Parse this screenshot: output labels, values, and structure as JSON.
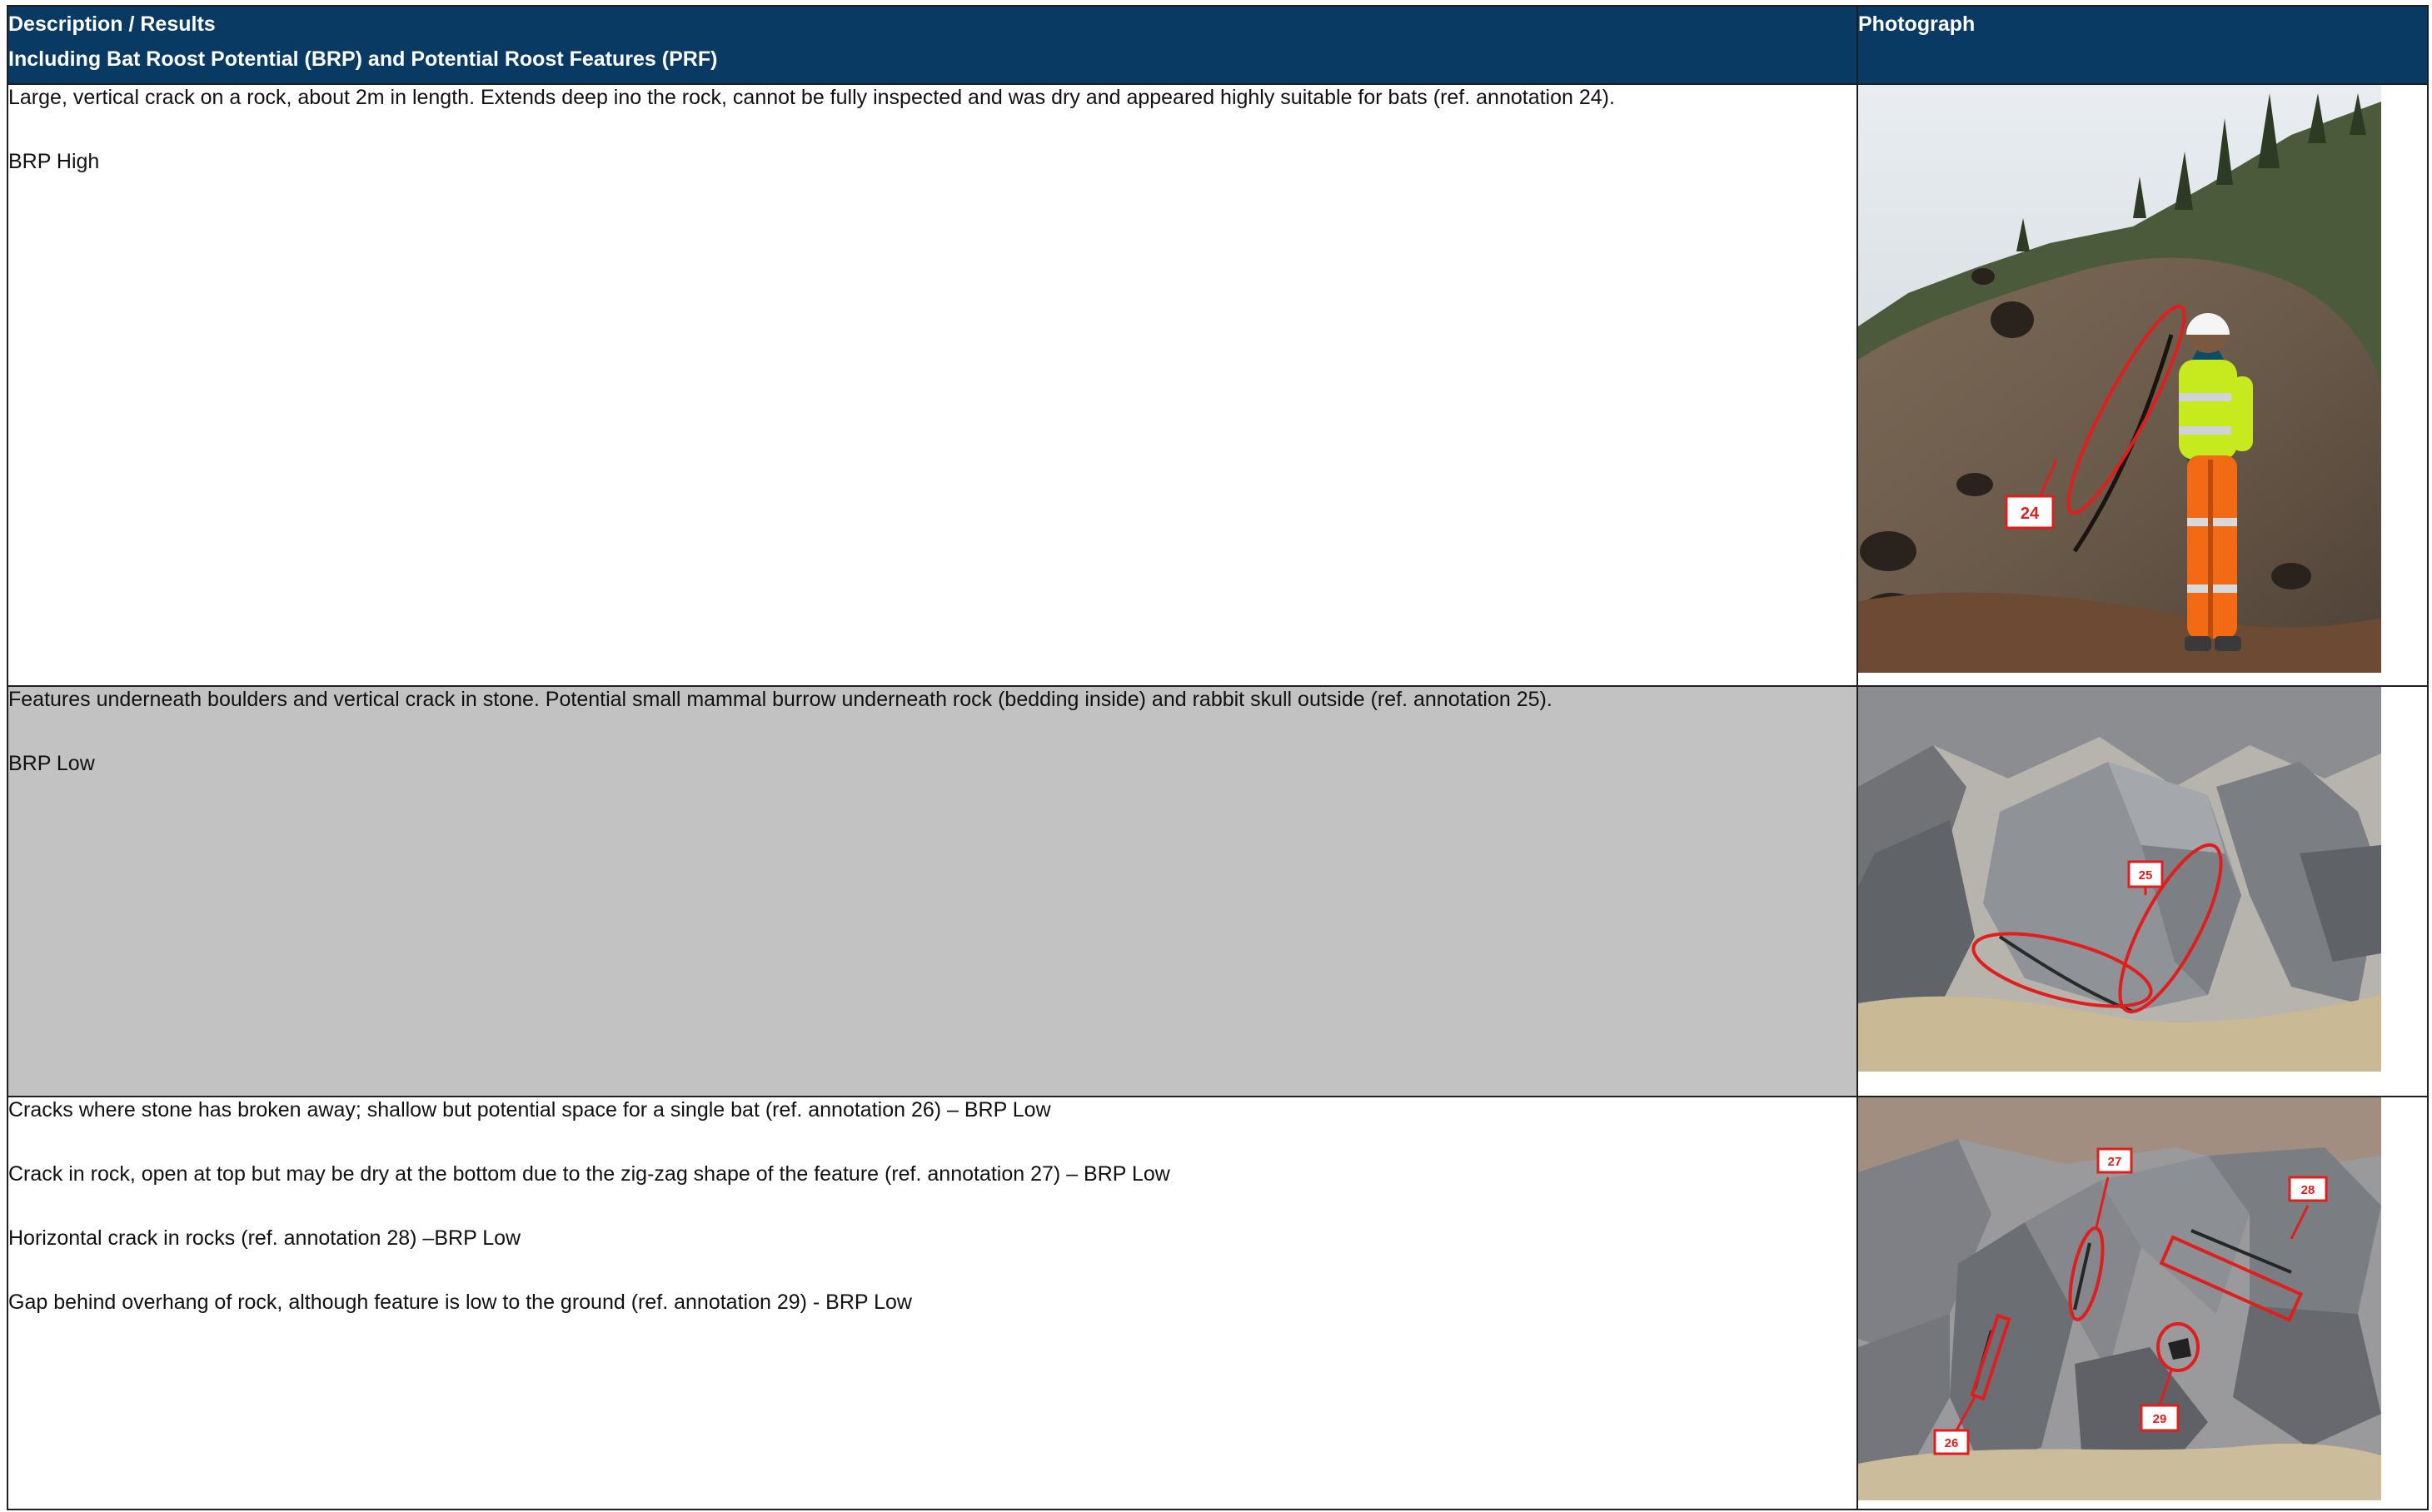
{
  "header": {
    "description_line1": "Description / Results",
    "description_line2": "Including Bat Roost Potential (BRP) and Potential Roost Features (PRF)",
    "photograph": "Photograph"
  },
  "rows": [
    {
      "paragraphs": [
        "Large, vertical crack on a rock, about 2m in length.  Extends deep ino the rock, cannot be fully inspected and was dry and appeared highly suitable for bats (ref. annotation 24).",
        "BRP High"
      ],
      "annotations": [
        "24"
      ]
    },
    {
      "paragraphs": [
        "Features underneath boulders and vertical crack in stone.  Potential small mammal burrow underneath rock (bedding inside) and rabbit skull outside (ref. annotation 25).",
        "BRP Low"
      ],
      "annotations": [
        "25"
      ]
    },
    {
      "paragraphs": [
        "Cracks where stone has broken away; shallow but potential space for a single bat (ref. annotation 26) – BRP Low",
        "Crack in rock, open at top but may be dry at the bottom due to the zig-zag shape of the feature (ref. annotation 27) – BRP Low",
        "Horizontal crack in rocks (ref. annotation 28) –BRP Low",
        "Gap behind overhang of rock, although feature is low to the ground (ref. annotation 29) - BRP Low"
      ],
      "annotations": [
        "26",
        "27",
        "28",
        "29"
      ]
    }
  ],
  "colors": {
    "header_bg": "#083a63",
    "header_text": "#ffffff",
    "shaded_row": "#c2c2c2",
    "annotation_red": "#e01e1e"
  }
}
